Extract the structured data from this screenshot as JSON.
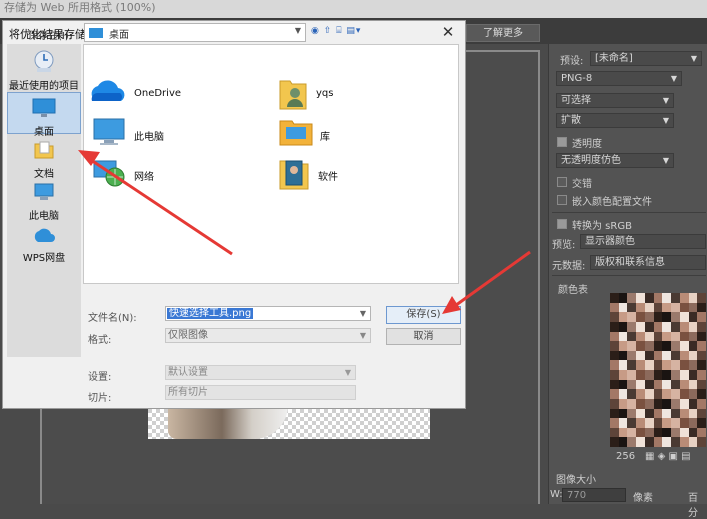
{
  "background_window": {
    "title": "存储为 Web 所用格式 (100%)",
    "learn_more": "了解更多"
  },
  "right_panel": {
    "preset_label": "预设:",
    "preset_value": "[未命名]",
    "format_value": "PNG-8",
    "reduction_value": "可选择",
    "dither_value": "扩散",
    "transparency_label": "透明度",
    "transparency_dither_value": "无透明度仿色",
    "interlaced_label": "交错",
    "embed_profile_label": "嵌入颜色配置文件",
    "convert_srgb_label": "转换为 sRGB",
    "preview_label": "预览:",
    "preview_value": "显示器颜色",
    "metadata_label": "元数据:",
    "metadata_value": "版权和联系信息",
    "color_table_label": "颜色表",
    "color_count": "256",
    "image_size_label": "图像大小",
    "width_label": "W:",
    "width_value": "770",
    "pixels_label": "像素",
    "percent_label": "百分"
  },
  "dialog": {
    "title": "将优化结果存储为",
    "close_icon": "close-icon",
    "save_in_label": "保存在(I):",
    "save_in_value": "桌面",
    "nav_icons": "◉ ⇧ ⌸ ▤▾",
    "places": [
      {
        "label": "最近使用的项目",
        "icon": "recent-icon"
      },
      {
        "label": "桌面",
        "icon": "desktop-icon",
        "selected": true
      },
      {
        "label": "文档",
        "icon": "documents-icon"
      },
      {
        "label": "此电脑",
        "icon": "computer-icon"
      },
      {
        "label": "WPS网盘",
        "icon": "wps-cloud-icon"
      }
    ],
    "files": [
      {
        "label": "OneDrive",
        "icon": "onedrive-icon"
      },
      {
        "label": "yqs",
        "icon": "user-folder-icon"
      },
      {
        "label": "此电脑",
        "icon": "computer-icon"
      },
      {
        "label": "库",
        "icon": "library-icon"
      },
      {
        "label": "网络",
        "icon": "network-icon"
      },
      {
        "label": "软件",
        "icon": "software-folder-icon"
      }
    ],
    "filename_label": "文件名(N):",
    "filename_value": "快速选择工具.png",
    "format_label": "格式:",
    "format_value": "仅限图像",
    "save_button": "保存(S)",
    "cancel_button": "取消",
    "settings_label": "设置:",
    "settings_value": "默认设置",
    "slices_label": "切片:",
    "slices_value": "所有切片"
  },
  "colors": {
    "accent_blue": "#2f8fd8",
    "arrow_red": "#e53935",
    "selection_blue": "#3a78d4"
  }
}
